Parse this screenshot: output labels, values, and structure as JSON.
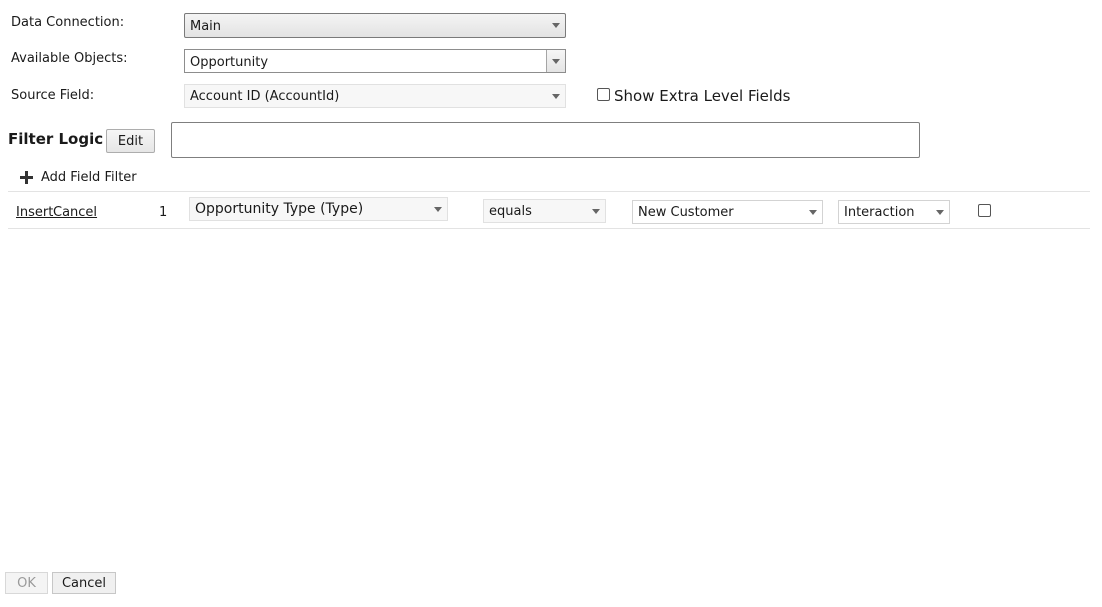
{
  "labels": {
    "data_connection": "Data Connection:",
    "available_objects": "Available Objects:",
    "source_field": "Source Field:"
  },
  "selects": {
    "data_connection": "Main",
    "available_objects": "Opportunity",
    "source_field": "Account ID (AccountId)"
  },
  "show_extra_level_fields": {
    "label": "Show Extra Level Fields",
    "checked": false
  },
  "filter_logic": {
    "title": "Filter Logic",
    "edit_label": "Edit",
    "value": ""
  },
  "add_field_filter": {
    "icon": "plus-icon",
    "label": "Add Field Filter"
  },
  "filters": [
    {
      "insert_label": "Insert",
      "cancel_label": "Cancel",
      "index": "1",
      "field": "Opportunity Type (Type)",
      "operator": "equals",
      "value": "New Customer",
      "category": "Interaction",
      "checked": false
    }
  ],
  "footer": {
    "ok_label": "OK",
    "cancel_label": "Cancel"
  }
}
